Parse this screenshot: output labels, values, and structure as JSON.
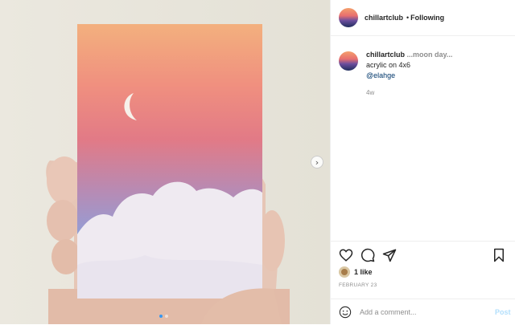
{
  "post": {
    "username": "chillartclub",
    "separator": "•",
    "following_label": "Following"
  },
  "caption": {
    "username": "chillartclub",
    "title": "...moon day...",
    "line": "acrylic on 4x6",
    "tag": "@elahge",
    "time": "4w"
  },
  "engagement": {
    "likes": "1 like",
    "date": "FEBRUARY 23"
  },
  "comment": {
    "placeholder": "Add a comment...",
    "post_label": "Post"
  },
  "icons": {
    "like": "heart-icon",
    "comment": "comment-icon",
    "share": "paper-plane-icon",
    "save": "bookmark-icon",
    "emoji": "smile-icon",
    "next": "chevron-right-icon"
  },
  "carousel": {
    "slides": 2,
    "active": 1
  },
  "colors": {
    "link": "#00376b",
    "post_disabled": "#b2dffc",
    "carousel_active": "#3897f0"
  }
}
